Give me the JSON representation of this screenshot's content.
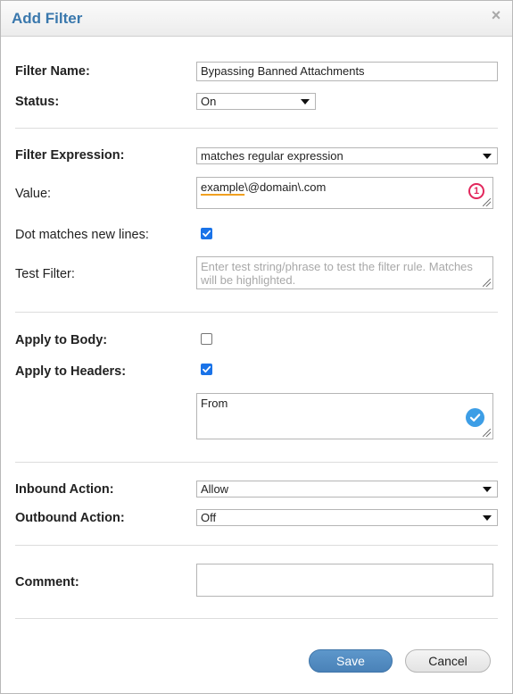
{
  "dialog": {
    "title": "Add Filter"
  },
  "filter_name": {
    "label": "Filter Name:",
    "value": "Bypassing Banned Attachments"
  },
  "status": {
    "label": "Status:",
    "value": "On"
  },
  "filter_expression": {
    "label": "Filter Expression:",
    "value": "matches regular expression"
  },
  "value_field": {
    "label": "Value:",
    "value_underlined": "example",
    "value_rest": "\\@domain\\.com",
    "error_badge": "1"
  },
  "dot_matches": {
    "label": "Dot matches new lines:",
    "checked": true
  },
  "test_filter": {
    "label": "Test Filter:",
    "placeholder": "Enter test string/phrase to test the filter rule. Matches will be highlighted."
  },
  "apply_body": {
    "label": "Apply to Body:",
    "checked": false
  },
  "apply_headers": {
    "label": "Apply to Headers:",
    "checked": true,
    "headers_value": "From"
  },
  "inbound_action": {
    "label": "Inbound Action:",
    "value": "Allow"
  },
  "outbound_action": {
    "label": "Outbound Action:",
    "value": "Off"
  },
  "comment": {
    "label": "Comment:",
    "value": ""
  },
  "buttons": {
    "save": "Save",
    "cancel": "Cancel"
  },
  "colors": {
    "title": "#3a78ad",
    "checkbox_on": "#1a73e8",
    "error": "#e2275c",
    "valid": "#3d9ee6",
    "save_button": "#4a82b8"
  }
}
